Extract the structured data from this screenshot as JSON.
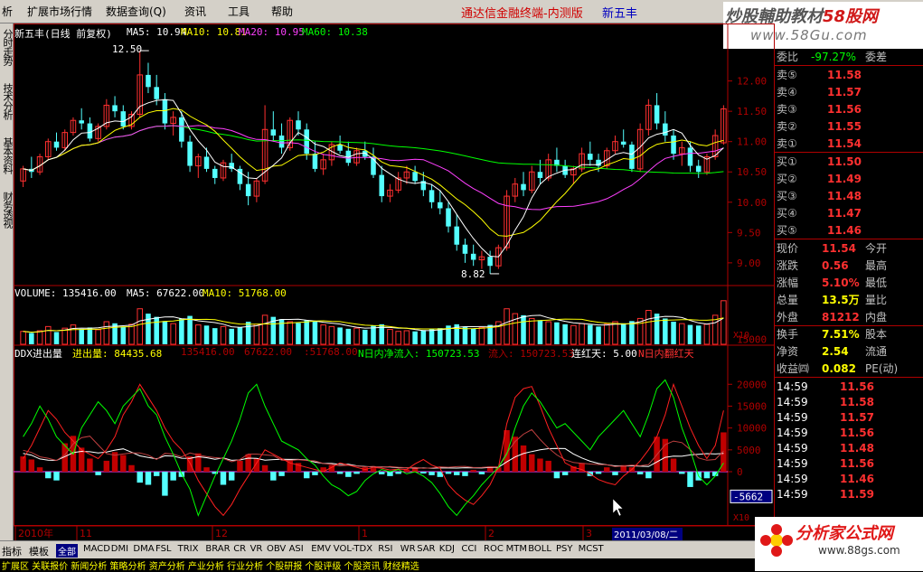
{
  "menu": [
    "析",
    "扩展市场行情",
    "数据查询(Q)",
    "资讯",
    "工具",
    "帮助"
  ],
  "brand_title": "通达信金融终端-内测版",
  "brand_stock": "新五丰",
  "watermark": {
    "line1_a": "炒股輔助教材",
    "line1_b": "58股网",
    "line2": "www.58Gu.com"
  },
  "left_tabs": [
    "分时走势",
    "技术分析",
    "基本资料",
    "财务透视"
  ],
  "main_header": {
    "stock": "新五丰(日线 前复权)",
    "ma5": "MA5: 10.94",
    "ma10": "MA10: 10.81",
    "ma20": "MA20: 10.95",
    "ma60": "MA60: 10.38"
  },
  "price_labels": {
    "high": "12.50",
    "low": "8.82"
  },
  "price_axis": [
    "12.00",
    "11.50",
    "11.00",
    "10.50",
    "10.00",
    "9.50",
    "9.00"
  ],
  "volume_header": {
    "v": "VOLUME: 135416.00",
    "ma5": "MA5: 67622.00",
    "ma10": "MA10: 51768.00"
  },
  "volume_axis": {
    "tick": "15000",
    "unit": "X10"
  },
  "ddx_header": {
    "name": "DDX进出量",
    "a": "进出量: 84435.68",
    "b": "135416.00",
    "c": "67622.00",
    "d": ":51768.00",
    "e": "N日内净流入: 150723.53",
    "f": "流入: 150723.53",
    "g": "连红天: 5.00",
    "h": "N日内翻红天"
  },
  "ddx_axis": [
    "20000",
    "15000",
    "10000",
    "5000",
    "0",
    "-5662"
  ],
  "ddx_unit": "X10",
  "date_axis": [
    "2010年",
    "11",
    "12",
    "1",
    "2",
    "3"
  ],
  "date_cursor": "2011/03/08/二",
  "right_panel": {
    "weibi": {
      "label": "委比",
      "value": "-97.27%",
      "extra": "委差"
    },
    "sells": [
      {
        "label": "卖⑤",
        "price": "11.58"
      },
      {
        "label": "卖④",
        "price": "11.57"
      },
      {
        "label": "卖③",
        "price": "11.56"
      },
      {
        "label": "卖②",
        "price": "11.55"
      },
      {
        "label": "卖①",
        "price": "11.54"
      }
    ],
    "buys": [
      {
        "label": "买①",
        "price": "11.50"
      },
      {
        "label": "买②",
        "price": "11.49"
      },
      {
        "label": "买③",
        "price": "11.48"
      },
      {
        "label": "买④",
        "price": "11.47"
      },
      {
        "label": "买⑤",
        "price": "11.46"
      }
    ],
    "quotes": [
      {
        "l": "现价",
        "v": "11.54",
        "l2": "今开",
        "c": "#ff3030"
      },
      {
        "l": "涨跌",
        "v": "0.56",
        "l2": "最高",
        "c": "#ff3030"
      },
      {
        "l": "涨幅",
        "v": "5.10%",
        "l2": "最低",
        "c": "#ff3030"
      },
      {
        "l": "总量",
        "v": "13.5万",
        "l2": "量比",
        "c": "#ffff00"
      },
      {
        "l": "外盘",
        "v": "81212",
        "l2": "内盘",
        "c": "#ff3030"
      },
      {
        "l": "换手",
        "v": "7.51%",
        "l2": "股本",
        "c": "#ffff00"
      },
      {
        "l": "净资",
        "v": "2.54",
        "l2": "流通",
        "c": "#ffff00"
      },
      {
        "l": "收益㈣",
        "v": "0.082",
        "l2": "PE(动)",
        "c": "#ffff00"
      }
    ],
    "ticks": [
      {
        "t": "14:59",
        "p": "11.56",
        "c": "#ff3030"
      },
      {
        "t": "14:59",
        "p": "11.58",
        "c": "#ff3030"
      },
      {
        "t": "14:59",
        "p": "11.57",
        "c": "#ff3030"
      },
      {
        "t": "14:59",
        "p": "11.56",
        "c": "#ff3030"
      },
      {
        "t": "14:59",
        "p": "11.48",
        "c": "#ff3030"
      },
      {
        "t": "14:59",
        "p": "11.56",
        "c": "#ff3030"
      },
      {
        "t": "14:59",
        "p": "11.46",
        "c": "#ff3030"
      },
      {
        "t": "14:59",
        "p": "11.59",
        "c": "#ff3030"
      }
    ]
  },
  "bottom_tabs": [
    "指标",
    "模板",
    "全部",
    "MACD",
    "DMI",
    "DMA",
    "FSL",
    "TRIX",
    "BRAR",
    "CR",
    "VR",
    "OBV",
    "ASI",
    "EMV",
    "VOL-TDX",
    "RSI",
    "WR",
    "SAR",
    "KDJ",
    "CCI",
    "ROC",
    "MTM",
    "BOLL",
    "PSY",
    "MCST"
  ],
  "ticker_text": "扩展区  关联报价  新闻分析  策略分析  资产分析  产业分析  行业分析  个股研报  个股评级  个股资讯  财经精选",
  "banner_logo": {
    "title": "分析家公式网",
    "url": "www.88gs.com"
  },
  "colors": {
    "up": "#ff3030",
    "down": "#54ffff",
    "ma5": "#ffffff",
    "ma10": "#ffff00",
    "ma20": "#ff40ff",
    "ma60": "#00ff00",
    "axis": "#b00000"
  },
  "chart_data": {
    "type": "candlestick",
    "ohlc": [
      [
        10.35,
        10.6,
        10.25,
        10.55
      ],
      [
        10.55,
        10.75,
        10.4,
        10.5
      ],
      [
        10.5,
        10.8,
        10.45,
        10.75
      ],
      [
        10.75,
        11.05,
        10.7,
        11.0
      ],
      [
        11.0,
        11.15,
        10.85,
        10.9
      ],
      [
        10.9,
        11.2,
        10.85,
        11.15
      ],
      [
        11.15,
        11.4,
        11.1,
        11.35
      ],
      [
        11.35,
        11.55,
        11.2,
        11.3
      ],
      [
        11.3,
        11.4,
        11.0,
        11.05
      ],
      [
        11.05,
        11.3,
        11.0,
        11.25
      ],
      [
        11.25,
        11.7,
        11.2,
        11.6
      ],
      [
        11.6,
        11.75,
        11.4,
        11.5
      ],
      [
        11.5,
        11.6,
        11.2,
        11.25
      ],
      [
        11.25,
        11.5,
        11.2,
        11.45
      ],
      [
        11.45,
        12.5,
        11.4,
        12.1
      ],
      [
        12.1,
        12.3,
        11.8,
        11.9
      ],
      [
        11.9,
        12.1,
        11.6,
        11.7
      ],
      [
        11.7,
        11.8,
        11.2,
        11.3
      ],
      [
        11.3,
        11.5,
        11.1,
        11.4
      ],
      [
        11.4,
        11.5,
        10.9,
        11.0
      ],
      [
        11.0,
        11.1,
        10.5,
        10.6
      ],
      [
        10.6,
        10.8,
        10.4,
        10.75
      ],
      [
        10.75,
        10.9,
        10.5,
        10.55
      ],
      [
        10.55,
        10.6,
        10.3,
        10.4
      ],
      [
        10.4,
        10.7,
        10.35,
        10.65
      ],
      [
        10.65,
        10.8,
        10.5,
        10.55
      ],
      [
        10.55,
        10.6,
        10.2,
        10.3
      ],
      [
        10.3,
        10.5,
        9.95,
        10.1
      ],
      [
        10.1,
        10.4,
        10.0,
        10.35
      ],
      [
        10.35,
        11.6,
        10.3,
        11.2
      ],
      [
        11.2,
        11.5,
        11.0,
        11.1
      ],
      [
        11.1,
        11.3,
        10.8,
        10.9
      ],
      [
        10.9,
        11.4,
        10.85,
        11.35
      ],
      [
        11.35,
        11.5,
        11.1,
        11.2
      ],
      [
        11.2,
        11.3,
        10.7,
        10.8
      ],
      [
        10.8,
        11.0,
        10.5,
        10.55
      ],
      [
        10.55,
        10.8,
        10.45,
        10.7
      ],
      [
        10.7,
        11.0,
        10.6,
        10.95
      ],
      [
        10.95,
        11.1,
        10.8,
        10.85
      ],
      [
        10.85,
        11.0,
        10.6,
        10.65
      ],
      [
        10.65,
        10.9,
        10.6,
        10.85
      ],
      [
        10.85,
        11.0,
        10.7,
        10.75
      ],
      [
        10.75,
        10.9,
        10.4,
        10.45
      ],
      [
        10.45,
        10.6,
        10.0,
        10.1
      ],
      [
        10.1,
        10.3,
        10.0,
        10.2
      ],
      [
        10.2,
        10.5,
        10.15,
        10.4
      ],
      [
        10.4,
        10.6,
        10.3,
        10.5
      ],
      [
        10.5,
        10.6,
        10.3,
        10.35
      ],
      [
        10.35,
        10.5,
        10.1,
        10.2
      ],
      [
        10.2,
        10.3,
        9.9,
        10.0
      ],
      [
        10.0,
        10.2,
        9.8,
        9.9
      ],
      [
        9.9,
        10.0,
        9.5,
        9.6
      ],
      [
        9.6,
        9.8,
        9.2,
        9.3
      ],
      [
        9.3,
        9.4,
        9.0,
        9.15
      ],
      [
        9.15,
        9.3,
        8.95,
        9.05
      ],
      [
        9.05,
        9.2,
        8.9,
        9.1
      ],
      [
        9.1,
        9.2,
        8.82,
        8.95
      ],
      [
        8.95,
        9.3,
        8.9,
        9.25
      ],
      [
        9.25,
        10.2,
        9.2,
        10.1
      ],
      [
        10.1,
        10.4,
        10.0,
        10.3
      ],
      [
        10.3,
        10.5,
        10.1,
        10.2
      ],
      [
        10.2,
        10.6,
        10.15,
        10.5
      ],
      [
        10.5,
        10.7,
        10.3,
        10.4
      ],
      [
        10.4,
        10.8,
        10.35,
        10.7
      ],
      [
        10.7,
        10.9,
        10.5,
        10.6
      ],
      [
        10.6,
        10.7,
        10.4,
        10.45
      ],
      [
        10.45,
        10.6,
        10.3,
        10.55
      ],
      [
        10.55,
        10.9,
        10.5,
        10.8
      ],
      [
        10.8,
        11.0,
        10.6,
        10.7
      ],
      [
        10.7,
        10.8,
        10.5,
        10.6
      ],
      [
        10.6,
        10.9,
        10.55,
        10.85
      ],
      [
        10.85,
        11.1,
        10.8,
        11.0
      ],
      [
        11.0,
        11.2,
        10.9,
        10.95
      ],
      [
        10.95,
        11.0,
        10.5,
        10.55
      ],
      [
        10.55,
        11.3,
        10.5,
        11.2
      ],
      [
        11.2,
        11.7,
        11.1,
        11.6
      ],
      [
        11.6,
        11.8,
        11.2,
        11.3
      ],
      [
        11.3,
        11.5,
        11.0,
        11.1
      ],
      [
        11.1,
        11.2,
        10.7,
        10.8
      ],
      [
        10.8,
        11.0,
        10.6,
        10.9
      ],
      [
        10.9,
        11.0,
        10.5,
        10.6
      ],
      [
        10.6,
        10.7,
        10.4,
        10.5
      ],
      [
        10.5,
        10.8,
        10.45,
        10.75
      ],
      [
        10.75,
        11.2,
        10.7,
        11.1
      ],
      [
        10.98,
        11.6,
        10.95,
        11.54
      ]
    ],
    "volume": [
      40,
      35,
      42,
      55,
      38,
      50,
      60,
      48,
      52,
      45,
      70,
      65,
      55,
      62,
      110,
      95,
      85,
      72,
      64,
      80,
      88,
      60,
      58,
      50,
      55,
      48,
      52,
      70,
      62,
      90,
      85,
      78,
      70,
      66,
      74,
      72,
      60,
      55,
      52,
      48,
      50,
      45,
      58,
      62,
      46,
      40,
      42,
      40,
      44,
      48,
      50,
      58,
      62,
      55,
      48,
      52,
      60,
      70,
      110,
      95,
      90,
      80,
      75,
      70,
      68,
      62,
      58,
      64,
      60,
      55,
      62,
      70,
      65,
      72,
      80,
      105,
      95,
      80,
      70,
      64,
      60,
      58,
      62,
      90,
      135
    ],
    "ddx_bars": [
      3.5,
      2.8,
      1.0,
      -1.5,
      -2.0,
      6.5,
      8.2,
      5.5,
      3.0,
      -0.8,
      2.5,
      4.5,
      3.8,
      1.5,
      -2.5,
      -3.0,
      -1.0,
      -5.5,
      -2.0,
      -1.2,
      3.5,
      4.2,
      1.0,
      -0.5,
      -3.0,
      -2.0,
      2.5,
      4.0,
      3.0,
      1.5,
      -2.0,
      -1.0,
      2.8,
      2.0,
      -1.5,
      -0.8,
      1.0,
      1.5,
      -0.5,
      -1.2,
      -0.5,
      1.0,
      0.8,
      -0.6,
      -1.0,
      -0.5,
      0.5,
      0.8,
      -0.4,
      -0.8,
      -1.2,
      -0.5,
      -0.8,
      -1.0,
      0.4,
      -0.6,
      1.2,
      1.0,
      9.5,
      8.0,
      6.0,
      4.0,
      3.0,
      2.5,
      -1.5,
      -0.8,
      1.2,
      2.0,
      -1.0,
      -0.5,
      1.0,
      -0.8,
      1.5,
      1.0,
      -0.6,
      -1.5,
      8.0,
      7.5,
      3.0,
      -0.5,
      -3.5,
      -2.0,
      -1.5,
      -1.0,
      9.0
    ],
    "ddx_green": [
      8,
      11,
      15,
      12,
      8,
      6,
      4,
      10,
      13,
      16,
      14,
      11,
      15,
      17,
      19,
      15,
      13,
      8,
      4,
      -0.5,
      -4,
      -10,
      -5.5,
      -1,
      3,
      7,
      12,
      18,
      20,
      15,
      11,
      7,
      6,
      5,
      3,
      1.5,
      -1,
      -3,
      -4,
      -5.5,
      -4.5,
      -2,
      -0.5,
      0.5,
      0,
      0.5,
      -0.5,
      0,
      -1,
      -2.5,
      -5,
      -8,
      -10,
      -7.5,
      -5.5,
      -3,
      -1,
      1,
      4,
      10,
      15,
      18,
      16,
      13,
      10,
      11,
      9,
      7,
      5,
      8,
      10,
      12,
      14,
      11,
      8,
      13,
      19,
      21,
      17,
      10,
      5,
      -1,
      -3,
      -1,
      2
    ],
    "ddx_red": [
      3,
      6,
      10,
      14,
      12,
      9,
      7,
      5,
      4,
      3,
      5,
      8,
      13,
      16,
      20,
      17,
      14,
      10,
      7,
      5,
      2,
      -2,
      -5,
      -8,
      -10,
      -7.5,
      -4,
      -1,
      2,
      5,
      4,
      3,
      2,
      1.5,
      1,
      0.5,
      0,
      1,
      2,
      1.5,
      1,
      0.5,
      1,
      0.8,
      0.4,
      0.6,
      0.5,
      1.8,
      2.8,
      1.5,
      0.8,
      -3,
      -5,
      -6.5,
      -7.5,
      -5.5,
      -3,
      1,
      11,
      17,
      19,
      19.5,
      15,
      10,
      6,
      2,
      1,
      0.5,
      -0.5,
      -1.8,
      -2.5,
      -3,
      -1,
      0.5,
      2.5,
      5,
      8,
      13,
      20,
      15,
      10,
      6,
      3,
      6,
      14
    ],
    "ddx_unit": "X10"
  }
}
